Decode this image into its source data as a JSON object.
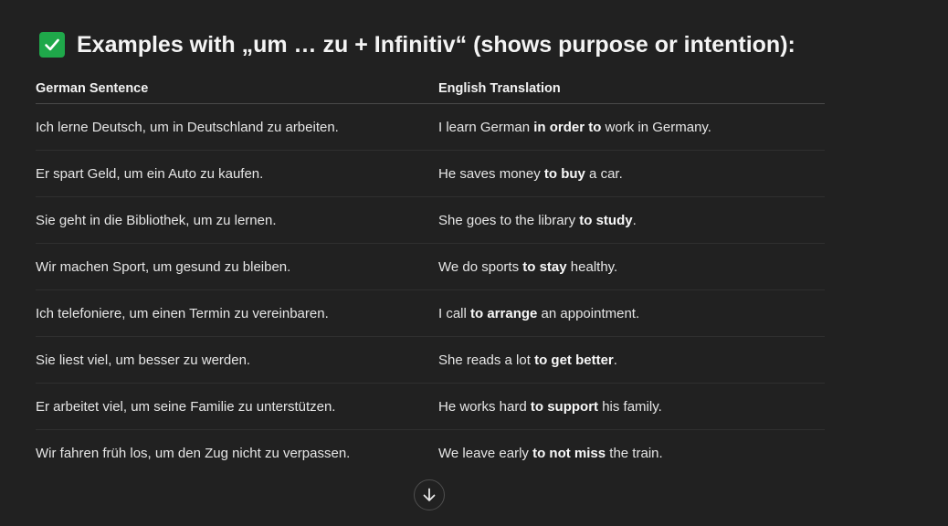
{
  "heading": {
    "icon": "check-mark-button-icon",
    "text": "Examples with „um … zu + Infinitiv“ (shows purpose or intention):"
  },
  "table": {
    "headers": [
      "German Sentence",
      "English Translation"
    ],
    "rows": [
      {
        "german": "Ich lerne Deutsch, um in Deutschland zu arbeiten.",
        "english": [
          {
            "t": "I learn German "
          },
          {
            "t": "in order to",
            "b": true
          },
          {
            "t": " work in Germany."
          }
        ]
      },
      {
        "german": "Er spart Geld, um ein Auto zu kaufen.",
        "english": [
          {
            "t": "He saves money "
          },
          {
            "t": "to buy",
            "b": true
          },
          {
            "t": " a car."
          }
        ]
      },
      {
        "german": "Sie geht in die Bibliothek, um zu lernen.",
        "english": [
          {
            "t": "She goes to the library "
          },
          {
            "t": "to study",
            "b": true
          },
          {
            "t": "."
          }
        ]
      },
      {
        "german": "Wir machen Sport, um gesund zu bleiben.",
        "english": [
          {
            "t": "We do sports "
          },
          {
            "t": "to stay",
            "b": true
          },
          {
            "t": " healthy."
          }
        ]
      },
      {
        "german": "Ich telefoniere, um einen Termin zu vereinbaren.",
        "english": [
          {
            "t": "I call "
          },
          {
            "t": "to arrange",
            "b": true
          },
          {
            "t": " an appointment."
          }
        ]
      },
      {
        "german": "Sie liest viel, um besser zu werden.",
        "english": [
          {
            "t": "She reads a lot "
          },
          {
            "t": "to get better",
            "b": true
          },
          {
            "t": "."
          }
        ]
      },
      {
        "german": "Er arbeitet viel, um seine Familie zu unterstützen.",
        "english": [
          {
            "t": "He works hard "
          },
          {
            "t": "to support",
            "b": true
          },
          {
            "t": " his family."
          }
        ]
      },
      {
        "german": "Wir fahren früh los, um den Zug nicht zu verpassen.",
        "english": [
          {
            "t": "We leave early "
          },
          {
            "t": "to not miss",
            "b": true
          },
          {
            "t": " the train."
          }
        ]
      }
    ]
  },
  "scroll_button": {
    "icon": "arrow-down-icon"
  },
  "colors": {
    "background": "#212121",
    "text": "#ececec",
    "check_green": "#1fa84a"
  }
}
